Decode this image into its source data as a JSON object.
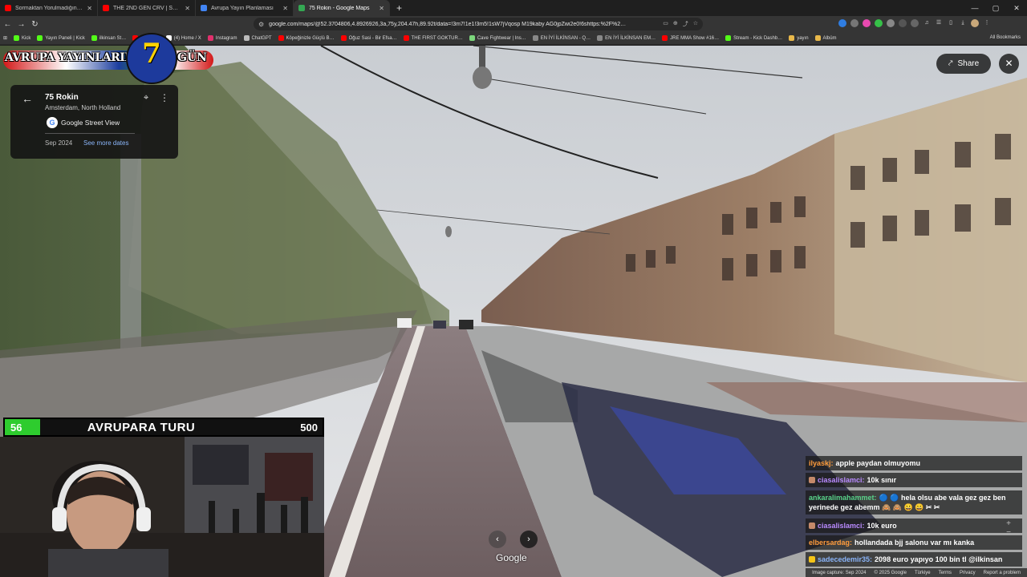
{
  "browser": {
    "tabs": [
      {
        "title": "Sormaktan Yorulmadığınız O Sorun…",
        "color": "#ff0000",
        "active": false
      },
      {
        "title": "THE 2ND GEN CRV | SHOULD YOU B…",
        "color": "#ff0000",
        "active": false
      },
      {
        "title": "Avrupa Yayın Planlaması",
        "color": "#4285f4",
        "active": false
      },
      {
        "title": "75 Rokin - Google Maps",
        "color": "#34a853",
        "active": true
      }
    ],
    "new_tab": "+",
    "window_controls": {
      "minimize": "—",
      "maximize": "▢",
      "close": "✕"
    },
    "nav": {
      "back": "←",
      "forward": "→",
      "reload": "↻"
    },
    "url": "google.com/maps/@52.3704806,4.8926926,3a,75y,204.47h,89.92t/data=!3m7!1e1!3m5!1sW7jVqosp M19kaby AG0jpZwi2e0!6shttps:%2F%2…",
    "bookmarks": [
      {
        "label": "Kick",
        "color": "#53fc18"
      },
      {
        "label": "Yayın Paneli | Kick",
        "color": "#53fc18"
      },
      {
        "label": "ilkinsan St…",
        "color": "#53fc18"
      },
      {
        "label": "YouTube",
        "color": "#ff0000"
      },
      {
        "label": "(4) Home / X",
        "color": "#ffffff"
      },
      {
        "label": "Instagram",
        "color": "#e1306c"
      },
      {
        "label": "ChatGPT",
        "color": "#bbbbbb"
      },
      {
        "label": "Köpeğinizle Güçlü B…",
        "color": "#ff0000"
      },
      {
        "label": "Oğuz Sasi - Bir Efsa…",
        "color": "#ff0000"
      },
      {
        "label": "THE FIRST GOKTUR…",
        "color": "#ff0000"
      },
      {
        "label": "Cave Fightwear | Ins…",
        "color": "#7cd67c"
      },
      {
        "label": "EN İYİ İLKİNSAN - Q…",
        "color": "#888888"
      },
      {
        "label": "EN İYİ İLKİNSAN EM…",
        "color": "#888888"
      },
      {
        "label": "JRE MMA Show #16…",
        "color": "#ff0000"
      },
      {
        "label": "Stream - Kick Dashb…",
        "color": "#53fc18"
      },
      {
        "label": "yayın",
        "color": "#e8b84a"
      },
      {
        "label": "Albüm",
        "color": "#e8b84a"
      }
    ],
    "all_bookmarks": "All Bookmarks"
  },
  "maps": {
    "place_title": "75 Rokin",
    "place_subtitle": "Amsterdam, North Holland",
    "provider": "Google Street View",
    "capture_date": "Sep 2024",
    "more_dates": "See more dates",
    "share": "Share",
    "google_mark": "Google",
    "footer": [
      "Image capture: Sep 2024",
      "© 2025 Google",
      "Türkiye",
      "Terms",
      "Privacy",
      "Report a problem"
    ]
  },
  "overlay": {
    "logo_text": "AVRUPA YAYINLARINA",
    "logo_number": "7",
    "logo_suffix": "GÜN",
    "counter_current": "56",
    "counter_title": "AVRUPARA TURU",
    "counter_goal": "500",
    "counter_progress": 0.112
  },
  "chat": [
    {
      "user": "ilyaskj:",
      "text": "apple paydan olmuyomu",
      "color": "#ff9c3c",
      "badge": ""
    },
    {
      "user": "ciasalislamci:",
      "text": "10k sınır",
      "color": "#b98aff",
      "badge": "#c58a6a"
    },
    {
      "user": "ankaralimahammet:",
      "text": "🔵 🔵 hela olsu abe vala gez gez ben yerinede gez abemm 🙈 🙈 😀 😀 ✂ ✂",
      "color": "#59d38a",
      "badge": ""
    },
    {
      "user": "ciasalislamci:",
      "text": "10k euro",
      "color": "#b98aff",
      "badge": "#c58a6a"
    },
    {
      "user": "elbersardag:",
      "text": "hollandada bjj salonu var mı kanka",
      "color": "#ff9c3c",
      "badge": ""
    },
    {
      "user": "sadecedemir35:",
      "text": "2098 euro yapıyo 100 bin tl @ilkinsan",
      "color": "#8ab4f8",
      "badge": "#f5c518"
    }
  ]
}
